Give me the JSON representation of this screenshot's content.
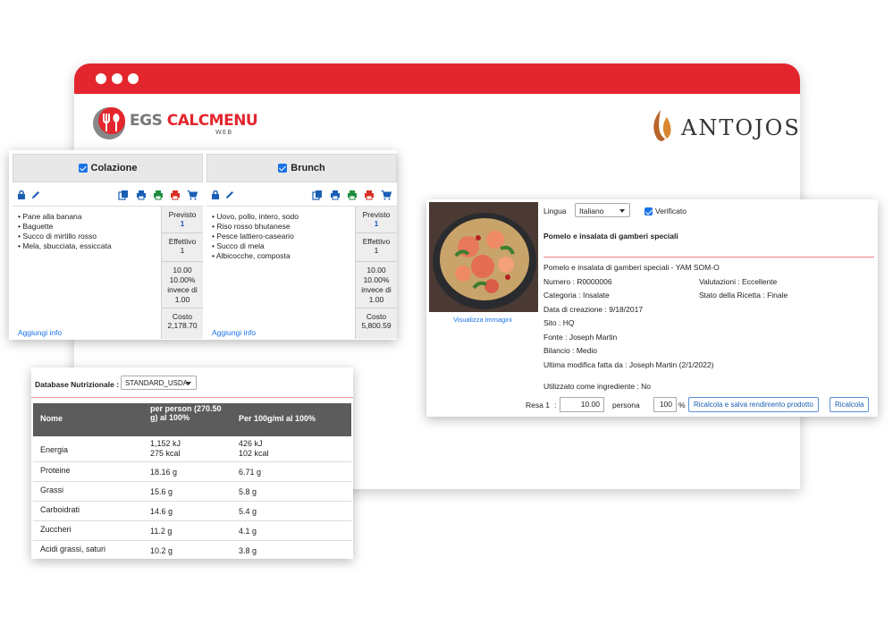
{
  "brand": {
    "app_logo_egs": "EGS",
    "app_logo_calc": "CALCMENU",
    "app_logo_web": "WEB",
    "client_logo": "ANTOJOS",
    "accent_color": "#e3262d"
  },
  "meal_plan": {
    "columns": [
      {
        "title": "Colazione",
        "checked": true,
        "items": [
          "Pane alla banana",
          "Baguette",
          "Succo di mirtillo rosso",
          "Mela, sbucciata, essiccata"
        ],
        "previsto_label": "Previsto",
        "previsto_value": "1",
        "effettivo_label": "Effettivo",
        "effettivo_value": "1",
        "ratio_lines": [
          "10.00",
          "10.00%",
          "invece di",
          "1.00"
        ],
        "costo_label": "Costo",
        "costo_value": "2,178.70",
        "add_info": "Aggiungi info"
      },
      {
        "title": "Brunch",
        "checked": true,
        "items": [
          "Uovo, pollo, intero, sodo",
          "Riso rosso bhutanese",
          "Pesce lattiero-caseario",
          "Succo di mela",
          "Albicocche, composta"
        ],
        "previsto_label": "Previsto",
        "previsto_value": "1",
        "effettivo_label": "Effettivo",
        "effettivo_value": "1",
        "ratio_lines": [
          "10.00",
          "10.00%",
          "invece di",
          "1.00"
        ],
        "costo_label": "Costo",
        "costo_value": "5,800.59",
        "add_info": "Aggiungi info"
      }
    ]
  },
  "recipe": {
    "view_images": "Visualizza immagini",
    "language_label": "Lingua",
    "language_value": "Italiano",
    "verified_label": "Verificato",
    "title": "Pomelo e insalata di gamberi speciali",
    "subtitle": "Pomelo e insalata di gamberi speciali - YAM SOM-O",
    "numero": "Numero : R0000006",
    "categoria_label": "Categoria : ",
    "categoria_value": "Insalate",
    "data_creazione": "Data di creazione : 9/18/2017",
    "sito": "Sito : HQ",
    "fonte_label": "Fonte : ",
    "fonte_value": "Joseph Martin",
    "bilancio": "Bilancio : Medio",
    "ultima_modifica_label": "Ultima modifica fatta da : Joseph Martin",
    "ultima_modifica_date": "(2/1/2022)",
    "valutazioni": "Valutazioni : Eccellente",
    "stato": "Stato della Ricetta : Finale",
    "utilizzato": "Utilizzato come ingrediente : No",
    "resa_label": "Resa 1",
    "resa_colon": ":",
    "resa_value": "10.00",
    "persona_label": "persona",
    "percent_value": "100",
    "percent_sign": "%",
    "btn_save": "Ricalcola e salva rendimento prodotto",
    "btn_recalc": "Ricalcola"
  },
  "nutrition": {
    "db_label": "Database Nutrizionale",
    "db_colon": ":",
    "db_value": "STANDARD_USDA",
    "headers": {
      "name": "Nome",
      "per_person": "per person (270.50 g) al 100%",
      "per_100": "Per 100g/ml al 100%"
    },
    "rows": [
      {
        "name": "Energia",
        "per_person": [
          "1,152 kJ",
          "275 kcal"
        ],
        "per_100": [
          "426 kJ",
          "102 kcal"
        ]
      },
      {
        "name": "Proteine",
        "per_person": [
          "18.16 g"
        ],
        "per_100": [
          "6.71 g"
        ]
      },
      {
        "name": "Grassi",
        "per_person": [
          "15.6 g"
        ],
        "per_100": [
          "5.8 g"
        ]
      },
      {
        "name": "Carboidrati",
        "per_person": [
          "14.6 g"
        ],
        "per_100": [
          "5.4 g"
        ]
      },
      {
        "name": "Zuccheri",
        "per_person": [
          "11.2 g"
        ],
        "per_100": [
          "4.1 g"
        ]
      },
      {
        "name": "Acidi grassi, saturi",
        "per_person": [
          "10.2 g"
        ],
        "per_100": [
          "3.8 g"
        ]
      }
    ]
  }
}
